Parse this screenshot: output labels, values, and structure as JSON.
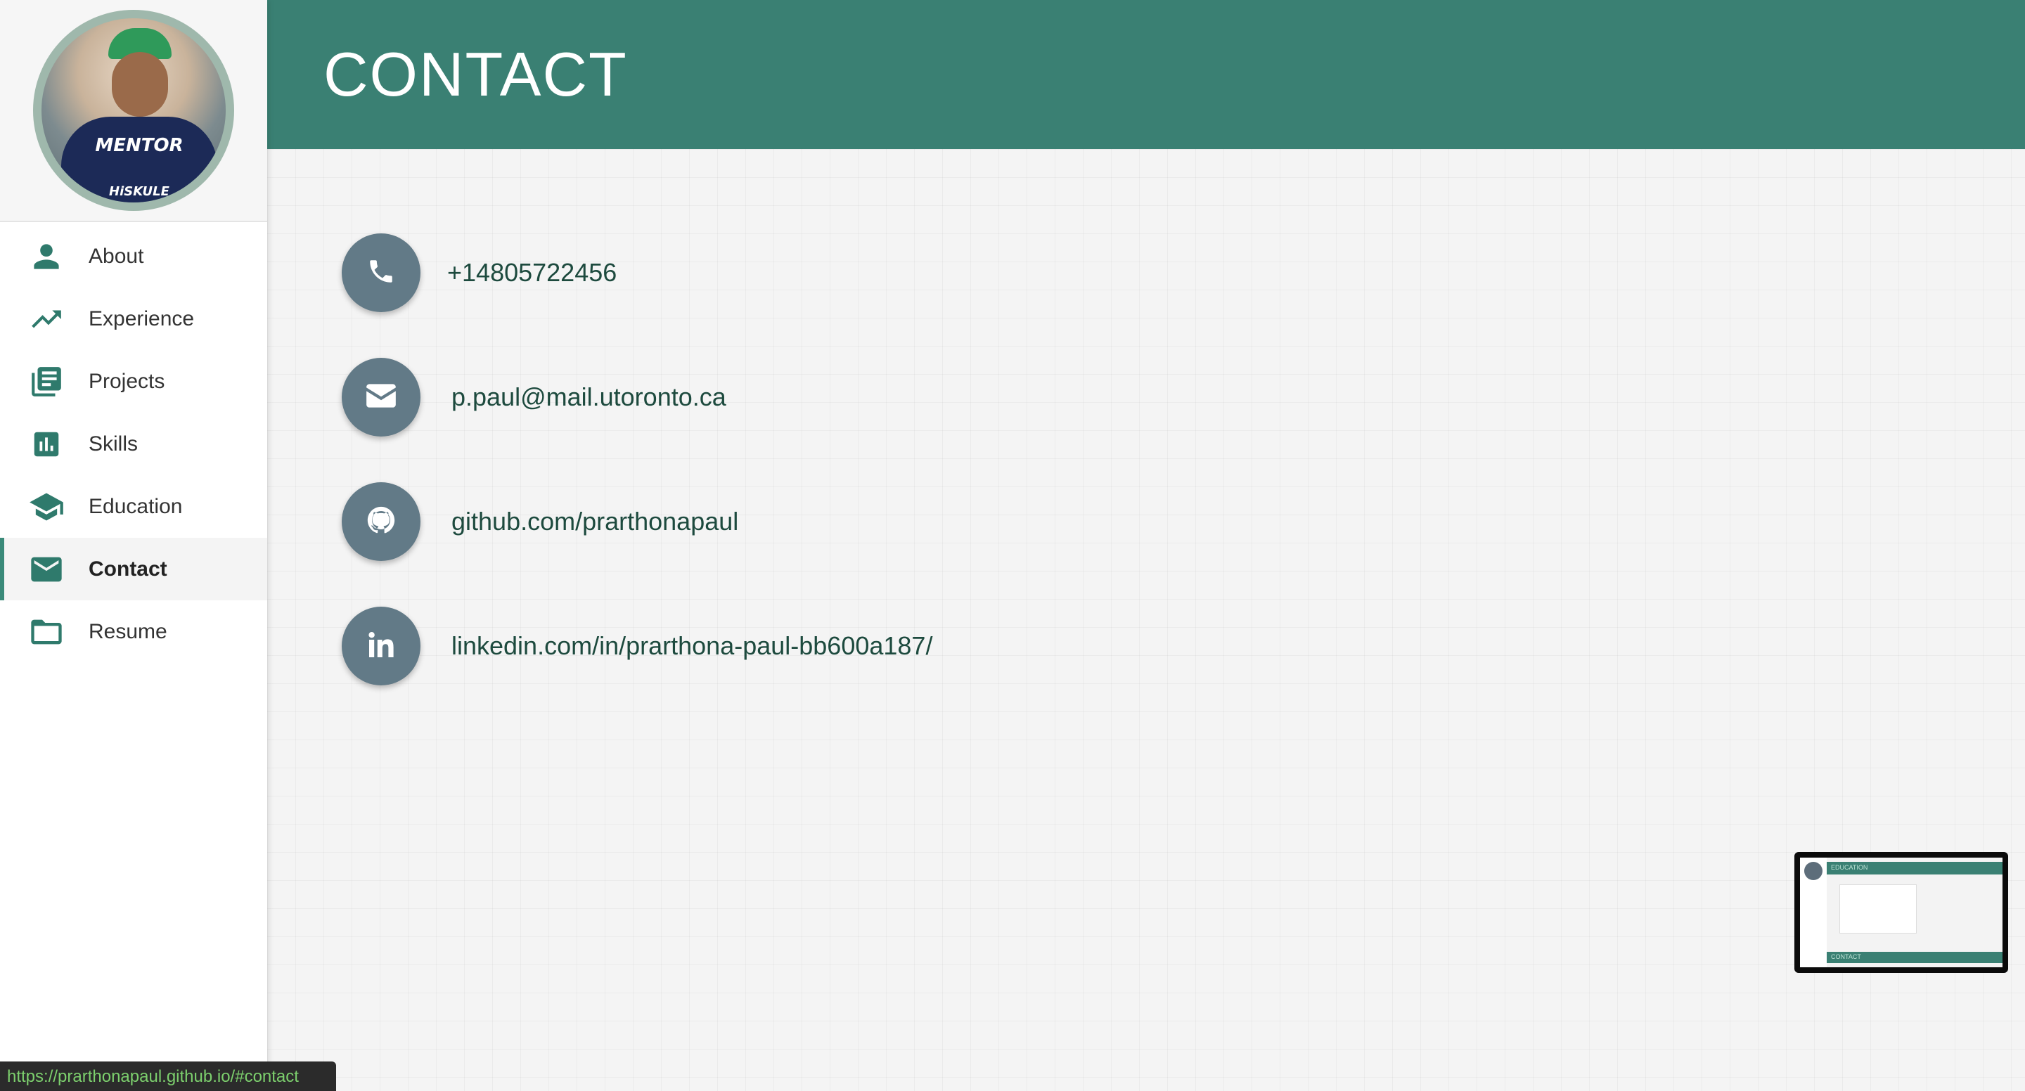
{
  "sidebar": {
    "avatar_alt": "MENTOR",
    "avatar_sub": "HiSKULE",
    "items": [
      {
        "label": "About",
        "icon": "person-icon"
      },
      {
        "label": "Experience",
        "icon": "trending-up-icon"
      },
      {
        "label": "Projects",
        "icon": "library-books-icon"
      },
      {
        "label": "Skills",
        "icon": "bar-chart-icon"
      },
      {
        "label": "Education",
        "icon": "graduation-cap-icon"
      },
      {
        "label": "Contact",
        "icon": "mail-icon",
        "active": true
      },
      {
        "label": "Resume",
        "icon": "folder-icon"
      }
    ]
  },
  "header": {
    "title": "CONTACT"
  },
  "contact": {
    "phone": "+14805722456",
    "email": "p.paul@mail.utoronto.ca",
    "github": "github.com/prarthonapaul",
    "linkedin": "linkedin.com/in/prarthona-paul-bb600a187/"
  },
  "status_bar": {
    "url": "https://prarthonapaul.github.io/#contact"
  },
  "thumbnail": {
    "top_label": "EDUCATION",
    "bottom_label": "CONTACT"
  },
  "colors": {
    "accent": "#3a8073",
    "icon_circle": "#627a87",
    "text_dark": "#1d4a3e"
  }
}
